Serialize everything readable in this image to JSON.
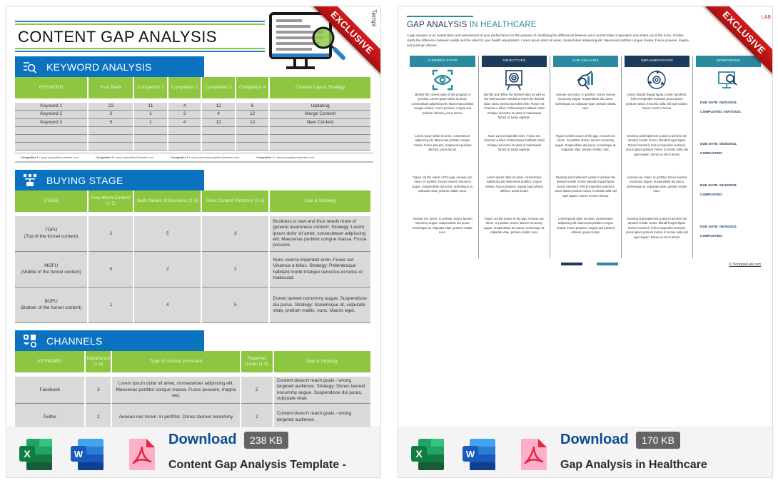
{
  "cards": [
    {
      "ribbon": "EXCLUSIVE",
      "preview": {
        "side_logo": "Templ",
        "title": "CONTENT GAP ANALYSIS",
        "keyword_section": {
          "title": "KEYWORD ANALYSIS",
          "icon": "keyword-search-icon",
          "headers": [
            "KEYWORD",
            "Your Rank",
            "Competitor 1",
            "Competitor 2",
            "Competitor 3",
            "Competitor 4",
            "Content Gap & Strategy"
          ],
          "rows": [
            [
              "Keyword 1",
              "23",
              "11",
              "4",
              "12",
              "6",
              "Updating"
            ],
            [
              "Keyword 2",
              "2",
              "1",
              "3",
              "4",
              "12",
              "Merge Content"
            ],
            [
              "Keyword 3",
              "5",
              "1",
              "4",
              "12",
              "13",
              "New Content"
            ],
            [
              "",
              "",
              "",
              "",
              "",
              "",
              ""
            ],
            [
              "",
              "",
              "",
              "",
              "",
              "",
              ""
            ],
            [
              "",
              "",
              "",
              "",
              "",
              "",
              ""
            ]
          ],
          "competitors": [
            {
              "label": "Competitor 1",
              "url": " • www.competitor1website.com"
            },
            {
              "label": "Competitor 2",
              "url": " • www.competitor2website.com"
            },
            {
              "label": "Competitor 3",
              "url": " • www.namesofcompetitor3website.com"
            },
            {
              "label": "Competitor 4",
              "url": " • www.competitor4website.com"
            }
          ]
        },
        "buying_section": {
          "title": "BUYING STAGE",
          "icon": "funnel-stage-icon",
          "headers": [
            "STAGE",
            "How Much Content (1-5)",
            "Suits Needs of Business (1-5)",
            "How Content Performs (1-5)",
            "Gap & Strategy"
          ],
          "rows": [
            {
              "stage": "TOFU",
              "sub": "(Top of the funnel content)",
              "a": "2",
              "b": "5",
              "c": "3",
              "gap": "Business is new and thus needs more of general awareness content. Strategy: Lorem ipsum dolor sit amet, consectetuer adipiscing elit. Maecenas porttitor congue massa. Fusce posuere."
            },
            {
              "stage": "MOFU",
              "sub": "(Middle of the funnel content)",
              "a": "5",
              "b": "2",
              "c": "2",
              "gap": "Nunc viverra imperdiet enim. Fusce est. Vivamus a tellus. Strategy: Pellentesque habitant morbi tristique senectus et netus et malesuad."
            },
            {
              "stage": "BOFU",
              "sub": "(Bottom of the funnel content)",
              "a": "1",
              "b": "4",
              "c": "5",
              "gap": "Donec laoreet nonummy augue. Suspendisse dui purus. Strategy: Scelerisque at, vulputate vitae, pretium mattis, nunc. Mauris eget."
            }
          ]
        },
        "channels_section": {
          "title": "CHANNELS",
          "icon": "social-channels-icon",
          "headers": [
            "KEYWORD",
            "Importance (1-5)",
            "Type of content promoted",
            "Reached Goals (1-5)",
            "Gap & Strategy"
          ],
          "rows": [
            {
              "channel": "Facebook",
              "importance": "3",
              "content": "Lorem ipsum dolor sit amet, consectetuer adipiscing elit. Maecenas porttitor congue massa. Fusce posuere, magna sed.",
              "goals": "2",
              "gap": "Content doesn't reach goals - wrong targeted audience. Strategy: Donec laoreet nonummy augue. Suspendisse dui purus, vulputate vitae."
            },
            {
              "channel": "Twitter",
              "importance": "2",
              "content": "Aenean nec lorem. In porttitor. Donec laoreet nonummy",
              "goals": "2",
              "gap": "Content doesn't reach goals - wrong targeted audience."
            }
          ]
        }
      },
      "footer": {
        "icons": [
          "excel-icon",
          "word-icon",
          "pdf-icon"
        ],
        "download_label": "Download",
        "file_size": "238 KB",
        "name": "Content Gap Analysis Template -"
      }
    },
    {
      "ribbon": "EXCLUSIVE",
      "preview": {
        "brand": "LAB",
        "title_main": "GAP ANALYSIS ",
        "title_highlight": "IN HEALTHCARE",
        "intro": "A gap analysis is an examination and assessment of your performance for the purpose of identifying the differences between your current state of operation and where you'd like to be. It helps clarify the difference between reality and the ideal for your health organization. Lorem ipsum dolor sit amet, consectetuer adipiscing elit. Maecenas porttitor congue massa. Fusce posuere, magna sed pulvinar ultricies.",
        "columns": [
          {
            "head": "CURRENT STATE",
            "icon": "eye-scan-icon",
            "texts": [
              "Identify the current state of the program or process. Lorem ipsum dolor sit amet, consectetuer adipiscing elit. Maecenas porttitor congue massa. Fusce posuere, magna sed pulvinar ultricies, purus lectus.",
              "Lorem ipsum dolor sit amet, consectetuer adipiscing elit. Maecenas porttitor congue massa. Fusce posuere, magna sed pulvinar ultricies, purus lectus.",
              "Figure out the nature of the gap. Aenean nec lorem. In porttitor. Donec laoreet nonummy augue. Suspendisse dui purus, scelerisque at, vulputate vitae, pretium mattis, nunc.",
              "Aenean nec lorem. In porttitor. Donec laoreet nonummy augue. Suspendisse dui purus, scelerisque at, vulputate vitae, pretium mattis, nunc."
            ]
          },
          {
            "head": "OBJECTIVES",
            "icon": "target-board-icon",
            "texts": [
              "Identify and define the desired state as well as the best practice needed to reach the desired state. Nunc viverra imperdiet enim. Fusce est. Vivamus a tellus. Pellentesque habitant morbi tristique senectus et netus et malesuada fames ac turpis egestas.",
              "Nunc viverra imperdiet enim. Fusce est. Vivamus a tellus. Pellentesque habitant morbi tristique senectus et netus et malesuada fames ac turpis egestas.",
              "Lorem ipsum dolor sit amet, consectetuer adipiscing elit. Maecenas porttitor congue massa. Fusce posuere, magna sed pulvinar ultricies, purus lectus.",
              "Figure out the nature of the gap. Aenean nec lorem. In porttitor. Donec laoreet nonummy augue. Suspendisse dui purus, scelerisque at, vulputate vitae, pretium mattis, nunc."
            ]
          },
          {
            "head": "GAP ANALYSIS",
            "icon": "chart-magnifier-icon",
            "texts": [
              "Aenean nec lorem. In porttitor. Donec laoreet nonummy augue. Suspendisse dui purus, scelerisque at, vulputate vitae, pretium mattis, nunc.",
              "Figure out the nature of the gap. Aenean nec lorem. In porttitor. Donec laoreet nonummy augue. Suspendisse dui purus, scelerisque at, vulputate vitae, pretium mattis, nunc.",
              "Develop and implement a plan to achieve the desired results. Donec blandit feugiat ligula. Donec hendrerit, felis et imperdiet euismod, purus ipsum pretium metus, in lacinia nulla nisl eget sapien. Donec ut est in lectus.",
              "Lorem ipsum dolor sit amet, consectetuer adipiscing elit. Maecenas porttitor congue massa. Fusce posuere, magna sed pulvinar ultricies, purus lectus."
            ]
          },
          {
            "head": "IMPLEMENTATION",
            "icon": "gear-cycle-icon",
            "texts": [
              "Donec blandit feugiat ligula. Donec hendrerit, felis et imperdiet euismod, purus ipsum pretium metus, in lacinia nulla nisl eget sapien. Donec ut est in lectus.",
              "Develop and implement a plan to achieve the desired results. Donec blandit feugiat ligula. Donec hendrerit, felis et imperdiet euismod, purus ipsum pretium metus, in lacinia nulla nisl eget sapien. Donec ut est in lectus.",
              "Aenean nec lorem. In porttitor. Donec laoreet nonummy augue. Suspendisse dui purus, scelerisque at, vulputate vitae, pretium mattis, nunc.",
              "Develop and implement a plan to achieve the desired results. Donec blandit feugiat ligula. Donec hendrerit, felis et imperdiet euismod, purus ipsum pretium metus, in lacinia nulla nisl eget sapien. Donec ut est in lectus."
            ]
          },
          {
            "head": "MONITORING",
            "icon": "monitor-search-icon",
            "due": [
              {
                "due": "DUE DATE: 05/01/2021",
                "completed": "COMPLETED: 05/07/2021"
              },
              {
                "due": "DUE DATE: 05/20/2021",
                "completed": "COMPLETED:"
              },
              {
                "due": "DUE DATE: 06/10/2021",
                "completed": "COMPLETED:"
              },
              {
                "due": "DUE DATE: 06/20/2021",
                "completed": "COMPLETED:"
              }
            ]
          }
        ],
        "copyright": "© TemplateLab.com"
      },
      "footer": {
        "icons": [
          "excel-icon",
          "word-icon",
          "pdf-icon"
        ],
        "download_label": "Download",
        "file_size": "170 KB",
        "name": "Gap Analysis in Healthcare"
      }
    }
  ],
  "colors": {
    "section_blue": "#0b72c0",
    "table_green": "#8dc63f",
    "teal": "#2a8ba0",
    "navy": "#1b3a5c",
    "download_blue": "#0b4d8f",
    "badge_gray": "#646464",
    "ribbon_red": "#c41616"
  }
}
